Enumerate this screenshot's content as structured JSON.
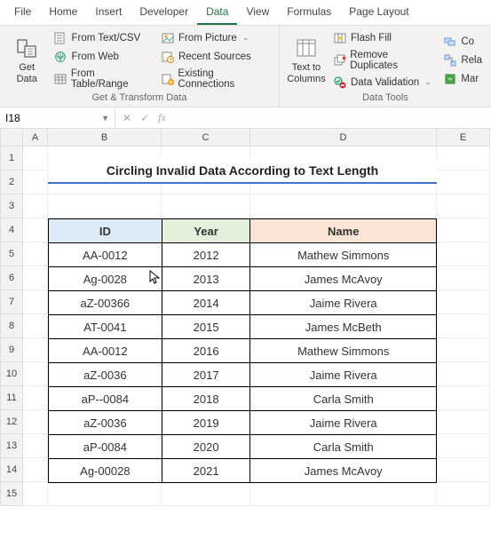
{
  "menubar": [
    "File",
    "Home",
    "Insert",
    "Developer",
    "Data",
    "View",
    "Formulas",
    "Page Layout"
  ],
  "menubar_active": 4,
  "ribbon": {
    "group1": {
      "label": "Get & Transform Data",
      "getdata": "Get\nData",
      "items": [
        "From Text/CSV",
        "From Web",
        "From Table/Range",
        "From Picture",
        "Recent Sources",
        "Existing Connections"
      ]
    },
    "group2": {
      "label": "Data Tools",
      "textcols": "Text to\nColumns",
      "items": [
        "Flash Fill",
        "Remove Duplicates",
        "Data Validation",
        "Co",
        "Rela",
        "Mar"
      ]
    }
  },
  "namebox": "I18",
  "row_headers": [
    "1",
    "2",
    "3",
    "4",
    "5",
    "6",
    "7",
    "8",
    "9",
    "10",
    "11",
    "12",
    "13",
    "14",
    "15"
  ],
  "col_headers": [
    "A",
    "B",
    "C",
    "D",
    "E"
  ],
  "title": "Circling Invalid Data According to Text Length",
  "table": {
    "headers": [
      "ID",
      "Year",
      "Name"
    ],
    "rows": [
      [
        "AA-0012",
        "2012",
        "Mathew Simmons"
      ],
      [
        "Ag-0028",
        "2013",
        "James McAvoy"
      ],
      [
        "aZ-00366",
        "2014",
        "Jaime Rivera"
      ],
      [
        "AT-0041",
        "2015",
        "James McBeth"
      ],
      [
        "AA-0012",
        "2016",
        "Mathew Simmons"
      ],
      [
        "aZ-0036",
        "2017",
        "Jaime Rivera"
      ],
      [
        "aP--0084",
        "2018",
        "Carla Smith"
      ],
      [
        "aZ-0036",
        "2019",
        "Jaime Rivera"
      ],
      [
        "aP-0084",
        "2020",
        "Carla Smith"
      ],
      [
        "Ag-00028",
        "2021",
        "James McAvoy"
      ]
    ]
  },
  "chart_data": {
    "type": "table",
    "title": "Circling Invalid Data According to Text Length",
    "columns": [
      "ID",
      "Year",
      "Name"
    ],
    "rows": [
      [
        "AA-0012",
        2012,
        "Mathew Simmons"
      ],
      [
        "Ag-0028",
        2013,
        "James McAvoy"
      ],
      [
        "aZ-00366",
        2014,
        "Jaime Rivera"
      ],
      [
        "AT-0041",
        2015,
        "James McBeth"
      ],
      [
        "AA-0012",
        2016,
        "Mathew Simmons"
      ],
      [
        "aZ-0036",
        2017,
        "Jaime Rivera"
      ],
      [
        "aP--0084",
        2018,
        "Carla Smith"
      ],
      [
        "aZ-0036",
        2019,
        "Jaime Rivera"
      ],
      [
        "aP-0084",
        2020,
        "Carla Smith"
      ],
      [
        "Ag-00028",
        2021,
        "James McAvoy"
      ]
    ]
  }
}
